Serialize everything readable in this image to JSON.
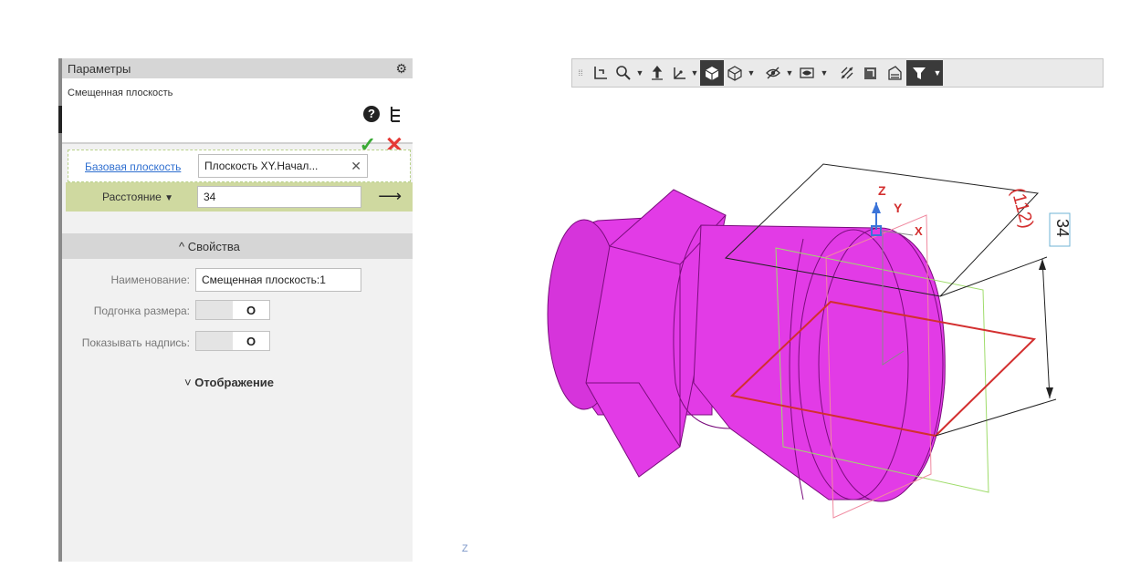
{
  "panel": {
    "title": "Параметры",
    "operation_name": "Смещенная плоскость",
    "base_plane": {
      "link_label": "Базовая плоскость",
      "value": "Плоскость XY.Начал..."
    },
    "distance": {
      "label": "Расстояние",
      "value": "34"
    },
    "properties": {
      "section_label": "Свойства",
      "name_label": "Наименование:",
      "name_value": "Смещенная плоскость:1",
      "fit_size_label": "Подгонка размера:",
      "show_label_label": "Показывать надпись:",
      "toggle_off_glyph": "O"
    },
    "display_section_label": "Отображение"
  },
  "viewport": {
    "axis_labels": {
      "x": "X",
      "y": "Y",
      "z": "Z"
    },
    "dimension_value": "34",
    "dimension_ref": "(112)",
    "bottom_axis_label": "Z"
  },
  "colors": {
    "part_fill": "#e23be6",
    "part_edge": "#7a0d7d",
    "plane_new": "#e53935",
    "plane_base": "#9fdc6b",
    "accent_green": "#3aaa35"
  }
}
